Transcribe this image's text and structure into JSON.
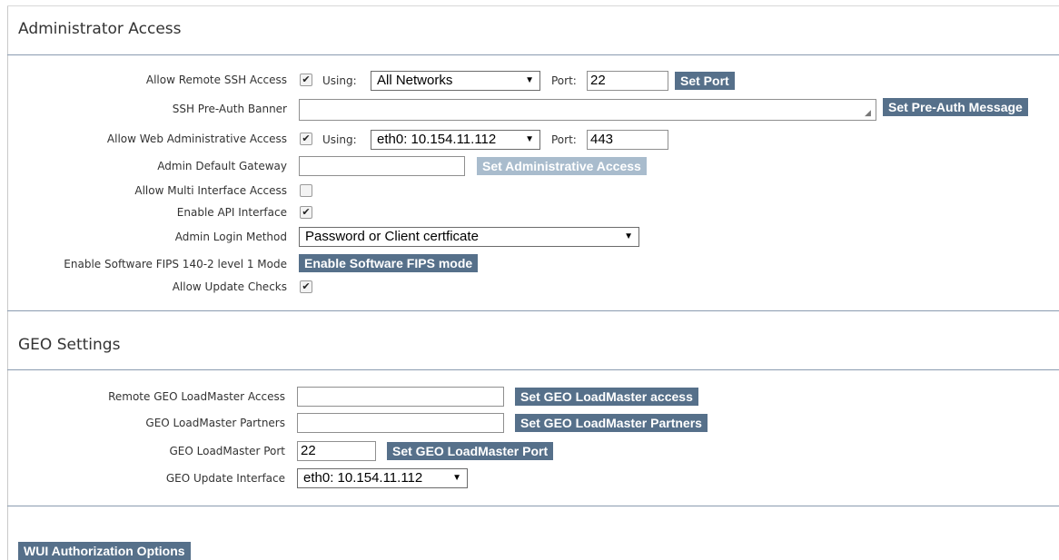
{
  "admin": {
    "title": "Administrator Access",
    "ssh": {
      "label": "Allow Remote SSH Access",
      "checked": "✔",
      "using_label": "Using:",
      "network": "All Networks",
      "port_label": "Port:",
      "port_value": "22",
      "button": "Set Port"
    },
    "banner": {
      "label": "SSH Pre-Auth Banner",
      "value": "",
      "button": "Set Pre-Auth Message"
    },
    "web": {
      "label": "Allow Web Administrative Access",
      "checked": "✔",
      "using_label": "Using:",
      "interface": "eth0: 10.154.11.112",
      "port_label": "Port:",
      "port_value": "443"
    },
    "gateway": {
      "label": "Admin Default Gateway",
      "value": "",
      "button": "Set Administrative Access"
    },
    "multi": {
      "label": "Allow Multi Interface Access",
      "checked": ""
    },
    "api": {
      "label": "Enable API Interface",
      "checked": "✔"
    },
    "login": {
      "label": "Admin Login Method",
      "value": "Password or Client certficate"
    },
    "fips": {
      "label": "Enable Software FIPS 140-2 level 1 Mode",
      "button": "Enable Software FIPS mode"
    },
    "updates": {
      "label": "Allow Update Checks",
      "checked": "✔"
    }
  },
  "geo": {
    "title": "GEO Settings",
    "access": {
      "label": "Remote GEO LoadMaster Access",
      "value": "",
      "button": "Set GEO LoadMaster access"
    },
    "partners": {
      "label": "GEO LoadMaster Partners",
      "value": "",
      "button": "Set GEO LoadMaster Partners"
    },
    "port": {
      "label": "GEO LoadMaster Port",
      "value": "22",
      "button": "Set GEO LoadMaster Port"
    },
    "interface": {
      "label": "GEO Update Interface",
      "value": "eth0: 10.154.11.112"
    }
  },
  "wui": {
    "button": "WUI Authorization Options"
  },
  "icons": {
    "dropdown": "▼",
    "resize": "◢"
  }
}
